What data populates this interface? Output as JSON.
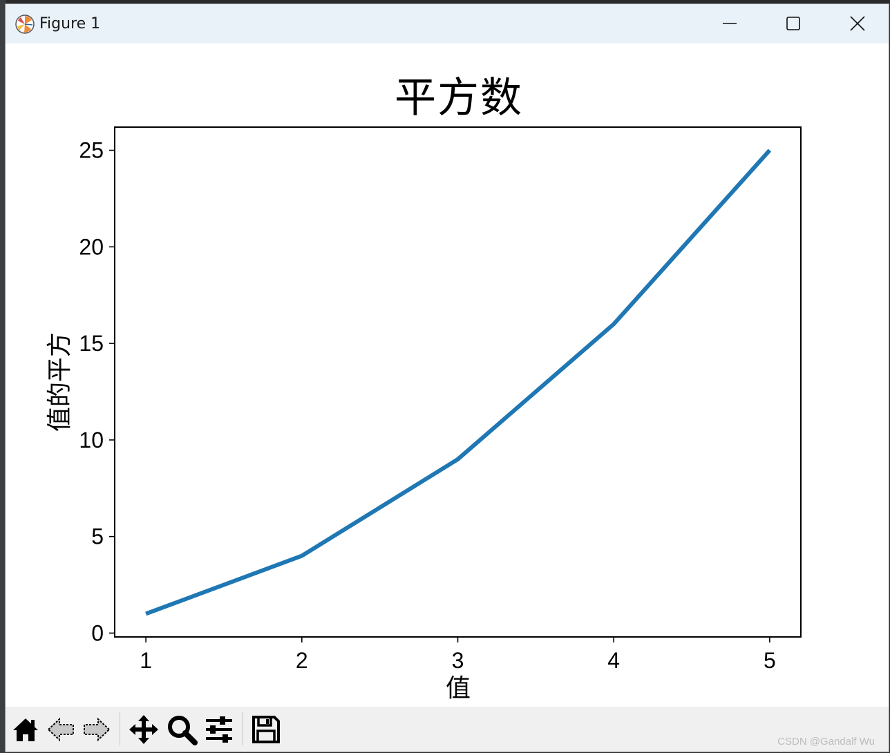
{
  "window": {
    "title": "Figure 1"
  },
  "toolbar": {
    "items": [
      "home-icon",
      "back-arrow-icon",
      "forward-arrow-icon",
      "pan-icon",
      "zoom-icon",
      "configure-subplots-icon",
      "save-icon"
    ]
  },
  "watermark": "CSDN @Gandalf Wu",
  "chart_data": {
    "type": "line",
    "title": "平方数",
    "xlabel": "值",
    "ylabel": "值的平方",
    "x": [
      1,
      2,
      3,
      4,
      5
    ],
    "series": [
      {
        "values": [
          1,
          4,
          9,
          16,
          25
        ],
        "color": "#1f77b4"
      }
    ],
    "xlim": [
      0.8,
      5.2
    ],
    "ylim": [
      -0.2,
      26.2
    ],
    "xticks": [
      1,
      2,
      3,
      4,
      5
    ],
    "yticks": [
      0,
      5,
      10,
      15,
      20,
      25
    ],
    "grid": false
  }
}
